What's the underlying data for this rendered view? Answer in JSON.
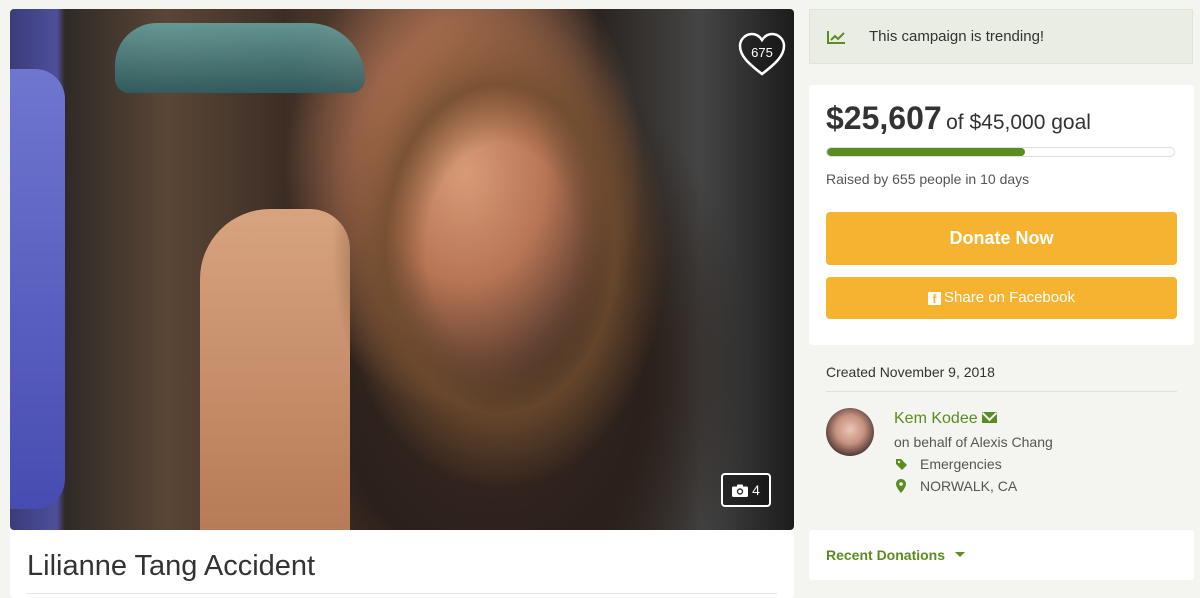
{
  "hero": {
    "heart_count": "675",
    "photo_count": "4"
  },
  "campaign": {
    "title": "Lilianne Tang Accident"
  },
  "trending": {
    "text": "This campaign is trending!",
    "icon": "trending-chart-icon"
  },
  "funding": {
    "raised": "$25,607",
    "goal_text": "of $45,000 goal",
    "progress_fraction": 0.57,
    "raised_by": "Raised by 655 people in 10 days",
    "donate_label": "Donate Now",
    "share_label": "Share on Facebook"
  },
  "meta": {
    "created": "Created November 9, 2018",
    "organizer": "Kem Kodee",
    "on_behalf": "on behalf of Alexis Chang",
    "category": "Emergencies",
    "location": "NORWALK, CA"
  },
  "recent": {
    "label": "Recent Donations"
  },
  "colors": {
    "brand_green": "#5b8c1f",
    "button_orange": "#f5b330"
  }
}
